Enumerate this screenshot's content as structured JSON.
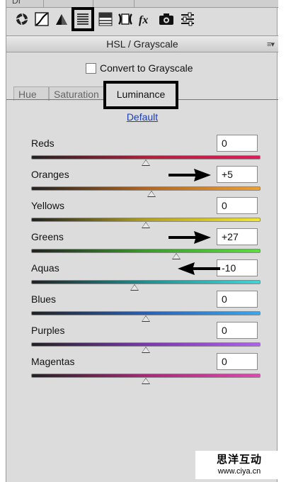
{
  "panel": {
    "title": "HSL / Grayscale",
    "top_clipped_text": "DI"
  },
  "toolbar": {
    "tools": [
      {
        "name": "basic",
        "icon": "aperture-icon"
      },
      {
        "name": "tone-curve",
        "icon": "tone-curve-icon"
      },
      {
        "name": "detail",
        "icon": "mountain-triangle-icon"
      },
      {
        "name": "hsl-grayscale",
        "icon": "hsl-lines-icon",
        "active": true
      },
      {
        "name": "split-toning",
        "icon": "split-toning-icon"
      },
      {
        "name": "lens-corrections",
        "icon": "lens-corrections-icon"
      },
      {
        "name": "effects",
        "icon": "fx-icon"
      },
      {
        "name": "camera-calibration",
        "icon": "camera-icon"
      },
      {
        "name": "presets",
        "icon": "sliders-settings-icon"
      }
    ]
  },
  "grayscale": {
    "label": "Convert to Grayscale",
    "checked": false
  },
  "tabs": [
    {
      "label": "Hue",
      "active": false
    },
    {
      "label": "Saturation",
      "active": false
    },
    {
      "label": "Luminance",
      "active": true
    }
  ],
  "default_link": "Default",
  "sliders": [
    {
      "label": "Reds",
      "value": "0",
      "level": 0,
      "gradient": [
        "#222222",
        "#b0203a",
        "#e11a5a"
      ],
      "arrow": null
    },
    {
      "label": "Oranges",
      "value": "+5",
      "level": 5,
      "gradient": [
        "#222222",
        "#b5651d",
        "#f0a030"
      ],
      "arrow": "right"
    },
    {
      "label": "Yellows",
      "value": "0",
      "level": 0,
      "gradient": [
        "#222222",
        "#b0a020",
        "#f2e830"
      ],
      "arrow": null
    },
    {
      "label": "Greens",
      "value": "+27",
      "level": 27,
      "gradient": [
        "#222222",
        "#3a9a2a",
        "#58e03a"
      ],
      "arrow": "right"
    },
    {
      "label": "Aquas",
      "value": "-10",
      "level": -10,
      "gradient": [
        "#222222",
        "#1f8e92",
        "#40d6d6"
      ],
      "arrow": "left"
    },
    {
      "label": "Blues",
      "value": "0",
      "level": 0,
      "gradient": [
        "#222222",
        "#2860b8",
        "#38a8f0"
      ],
      "arrow": null
    },
    {
      "label": "Purples",
      "value": "0",
      "level": 0,
      "gradient": [
        "#222222",
        "#7a38b0",
        "#b060f0"
      ],
      "arrow": null
    },
    {
      "label": "Magentas",
      "value": "0",
      "level": 0,
      "gradient": [
        "#222222",
        "#a82878",
        "#e048b0"
      ],
      "arrow": null
    }
  ],
  "watermark": {
    "cn": "思洋互动",
    "url": "www.ciya.cn"
  }
}
